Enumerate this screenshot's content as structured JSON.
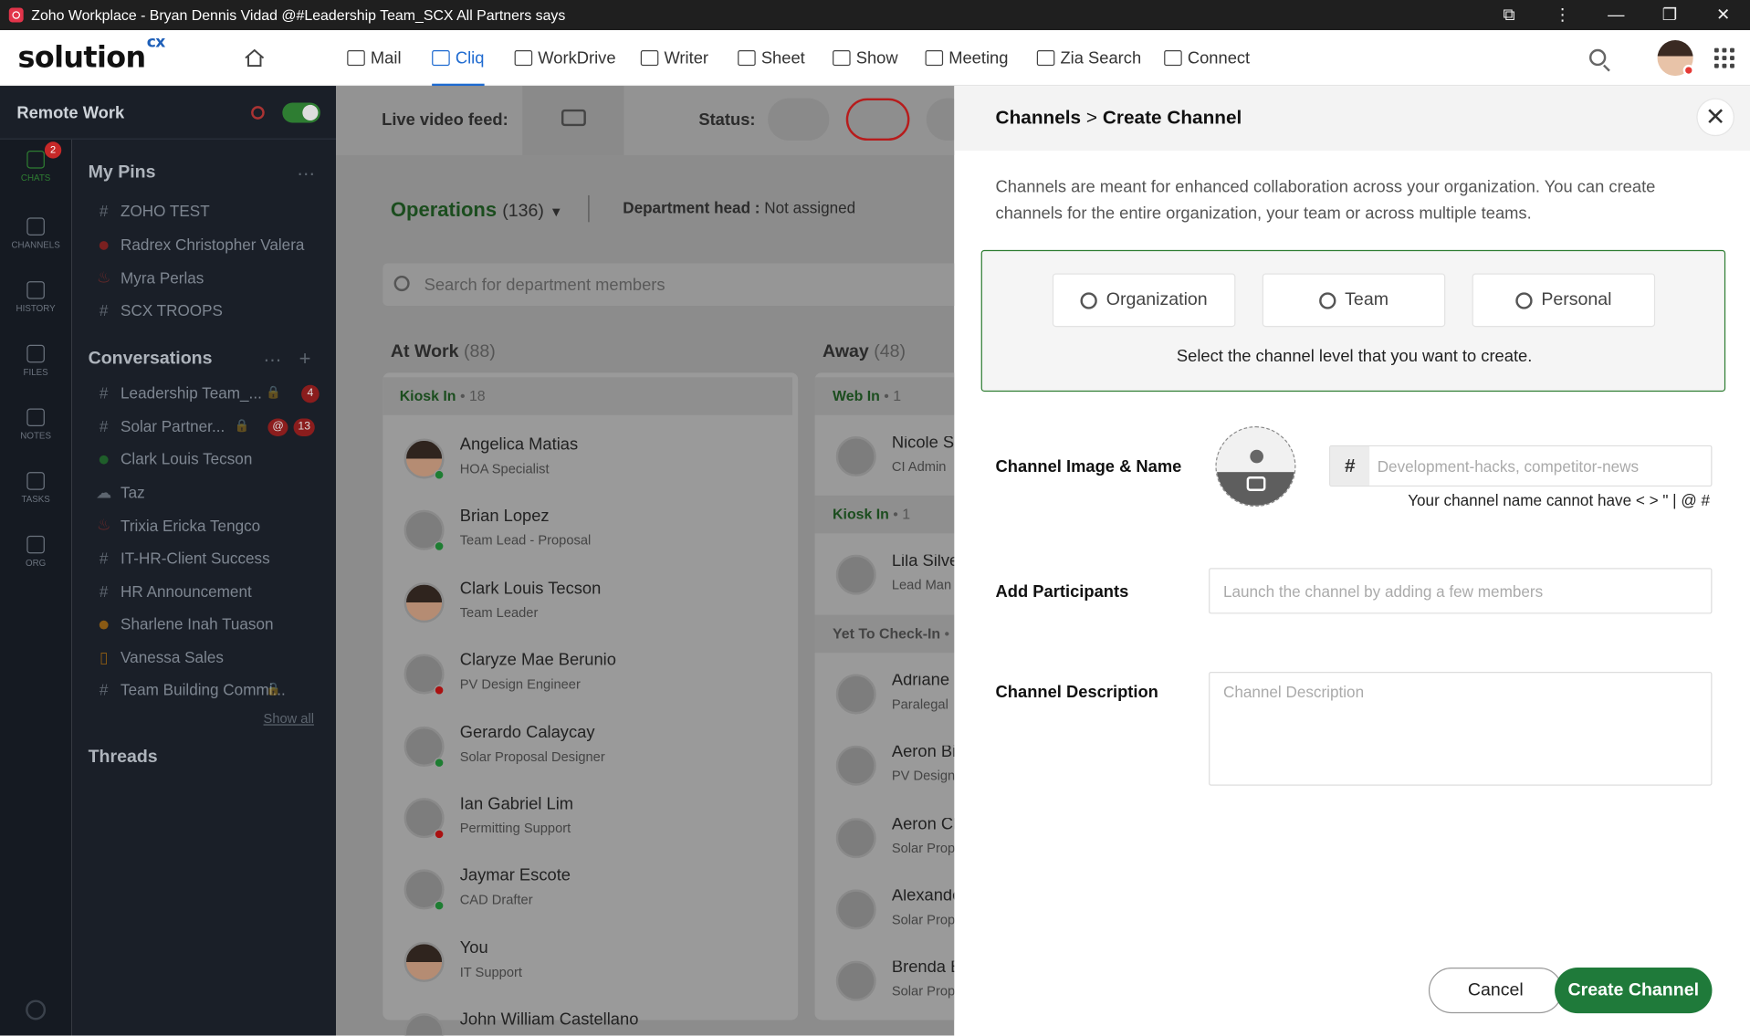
{
  "window": {
    "title": "Zoho Workplace - Bryan Dennis Vidad @#Leadership Team_SCX All Partners says"
  },
  "brand": {
    "logo": "solution",
    "logo_sup": "cx",
    "accent": "#1e6ad0",
    "green": "#1f7a3a"
  },
  "nav": {
    "items": [
      {
        "label": "Mail",
        "icon": "mail-icon"
      },
      {
        "label": "Cliq",
        "icon": "chat-icon",
        "active": true
      },
      {
        "label": "WorkDrive",
        "icon": "drive-icon"
      },
      {
        "label": "Writer",
        "icon": "writer-icon"
      },
      {
        "label": "Sheet",
        "icon": "sheet-icon"
      },
      {
        "label": "Show",
        "icon": "show-icon"
      },
      {
        "label": "Meeting",
        "icon": "meeting-icon"
      },
      {
        "label": "Zia Search",
        "icon": "zia-search-icon"
      },
      {
        "label": "Connect",
        "icon": "connect-icon"
      }
    ]
  },
  "rail": {
    "items": [
      {
        "label": "CHATS",
        "badge": "2"
      },
      {
        "label": "CHANNELS"
      },
      {
        "label": "HISTORY"
      },
      {
        "label": "FILES"
      },
      {
        "label": "NOTES"
      },
      {
        "label": "TASKS"
      },
      {
        "label": "ORG"
      }
    ]
  },
  "sidebar": {
    "workspace": "Remote Work",
    "pins_title": "My Pins",
    "pins": [
      {
        "mark": "#",
        "label": "ZOHO TEST"
      },
      {
        "mark": "dot-red",
        "label": "Radrex Christopher Valera"
      },
      {
        "mark": "leaf",
        "label": "Myra Perlas"
      },
      {
        "mark": "#",
        "label": "SCX TROOPS"
      }
    ],
    "conversations_title": "Conversations",
    "conversations": [
      {
        "mark": "#",
        "label": "Leadership Team_...",
        "lock": true,
        "badge": "4"
      },
      {
        "mark": "#",
        "label": "Solar Partner...",
        "lock": true,
        "mention": "@",
        "badge": "13"
      },
      {
        "mark": "dot-green",
        "label": "Clark Louis Tecson"
      },
      {
        "mark": "cloud",
        "label": "Taz"
      },
      {
        "mark": "leaf",
        "label": "Trixia Ericka Tengco"
      },
      {
        "mark": "#",
        "label": "IT-HR-Client Success"
      },
      {
        "mark": "#",
        "label": "HR Announcement"
      },
      {
        "mark": "dot-orange",
        "label": "Sharlene Inah Tuason"
      },
      {
        "mark": "phone",
        "label": "Vanessa Sales"
      },
      {
        "mark": "#",
        "label": "Team Building Commi...",
        "lock": true
      }
    ],
    "show_all": "Show all",
    "threads_title": "Threads"
  },
  "middle": {
    "live_feed_label": "Live video feed:",
    "status_label": "Status:",
    "department": "Operations",
    "department_count": "(136)",
    "dept_head_label": "Department head :",
    "dept_head_value": "Not assigned",
    "search_placeholder": "Search for department members",
    "at_work": {
      "title": "At Work",
      "count": "(88)",
      "group": "Kiosk In",
      "group_count": "• 18",
      "members": [
        {
          "name": "Angelica Matias",
          "role": "HOA Specialist",
          "status": "green",
          "photo": true
        },
        {
          "name": "Brian Lopez",
          "role": "Team Lead - Proposal",
          "status": "green"
        },
        {
          "name": "Clark Louis Tecson",
          "role": "Team Leader",
          "status": "none",
          "photo": true
        },
        {
          "name": "Claryze Mae Berunio",
          "role": "PV Design Engineer",
          "status": "red"
        },
        {
          "name": "Gerardo Calaycay",
          "role": "Solar Proposal Designer",
          "status": "green"
        },
        {
          "name": "Ian Gabriel Lim",
          "role": "Permitting Support",
          "status": "red"
        },
        {
          "name": "Jaymar Escote",
          "role": "CAD Drafter",
          "status": "green"
        },
        {
          "name": "You",
          "role": "IT Support",
          "status": "none",
          "photo": true
        },
        {
          "name": "John William Castellano",
          "role": "",
          "status": "none"
        }
      ]
    },
    "away": {
      "title": "Away",
      "count": "(48)",
      "groups": [
        {
          "name": "Web In",
          "count": "• 1",
          "members": [
            {
              "name": "Nicole Si",
              "role": "CI Admin"
            }
          ]
        },
        {
          "name": "Kiosk In",
          "count": "• 1",
          "members": [
            {
              "name": "Lila Silve",
              "role": "Lead Man"
            }
          ]
        },
        {
          "name": "Yet To Check-In",
          "count": "•",
          "members": [
            {
              "name": "Adriane",
              "role": "Paralegal"
            },
            {
              "name": "Aeron Bi",
              "role": "PV Design"
            },
            {
              "name": "Aeron Cl",
              "role": "Solar Prop"
            },
            {
              "name": "Alexande",
              "role": "Solar Prop"
            },
            {
              "name": "Brenda E",
              "role": "Solar Prop"
            }
          ]
        }
      ]
    }
  },
  "create_channel": {
    "breadcrumb_root": "Channels",
    "breadcrumb_sep": ">",
    "title": "Create Channel",
    "description": "Channels are meant for enhanced collaboration across your organization. You can create channels for the entire organization, your team or across multiple teams.",
    "levels": [
      {
        "label": "Organization",
        "icon": "organization-icon"
      },
      {
        "label": "Team",
        "icon": "team-icon"
      },
      {
        "label": "Personal",
        "icon": "personal-icon"
      }
    ],
    "level_hint": "Select the channel level that you want to create.",
    "image_name_label": "Channel Image & Name",
    "hash": "#",
    "name_placeholder": "Development-hacks, competitor-news",
    "name_hint": "Your channel name cannot have < > \" | @ #",
    "participants_label": "Add Participants",
    "participants_placeholder": "Launch the channel by adding a few members",
    "description_label": "Channel Description",
    "description_placeholder": "Channel Description",
    "cancel": "Cancel",
    "create": "Create Channel"
  }
}
